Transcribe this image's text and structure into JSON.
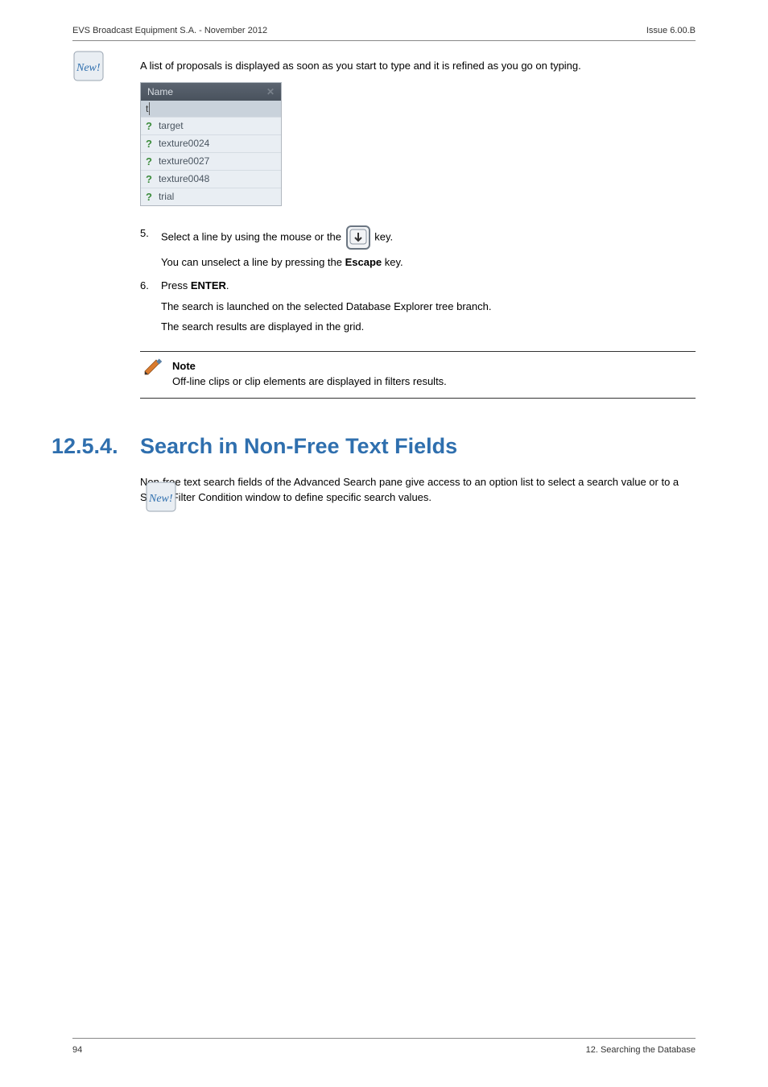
{
  "header": {
    "left": "EVS Broadcast Equipment S.A. - November 2012",
    "right": "Issue 6.00.B"
  },
  "badge1_text": "New!",
  "intro": "A list of proposals is displayed as soon as you start to type and it is refined as you go on typing.",
  "proposal": {
    "header": "Name",
    "close": "✕",
    "typed": "t",
    "items": [
      "target",
      "texture0024",
      "texture0027",
      "texture0048",
      "trial"
    ]
  },
  "step5": {
    "pre": "Select a line by using the mouse or the ",
    "post": " key.",
    "sub": "You can unselect a line by pressing the ",
    "escape": "Escape",
    "sub_post": " key."
  },
  "step6": {
    "line1_pre": "Press ",
    "line1_bold": "ENTER",
    "line1_post": ".",
    "sub1": "The search is launched on the selected Database Explorer tree branch.",
    "sub2": "The search results are displayed in the grid."
  },
  "note": {
    "title": "Note",
    "body": "Off-line clips or clip elements are displayed in filters results."
  },
  "section": {
    "number": "12.5.4.",
    "title": "Search in Non-Free Text Fields"
  },
  "badge2_text": "New!",
  "section_body": "Non-free text search fields of the Advanced Search pane give access to an option list to select a search value or to a Select Filter Condition window to define specific search values.",
  "footer": {
    "left": "94",
    "right": "12. Searching the Database"
  }
}
